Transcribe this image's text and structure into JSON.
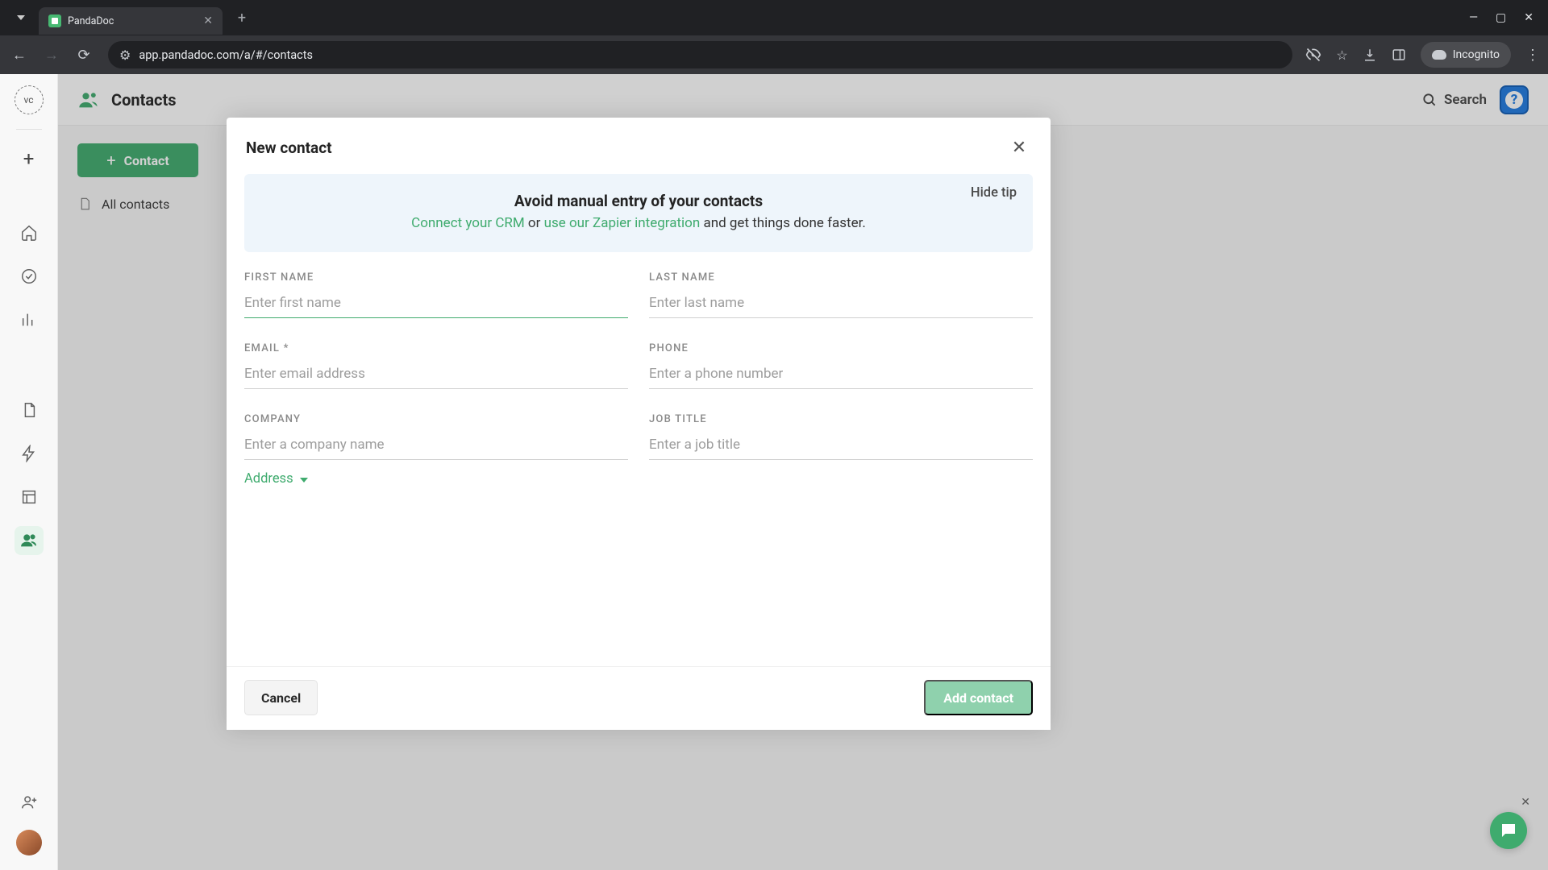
{
  "browser": {
    "tab_title": "PandaDoc",
    "url": "app.pandadoc.com/a/#/contacts",
    "incognito_label": "Incognito"
  },
  "header": {
    "title": "Contacts",
    "search_label": "Search"
  },
  "left_panel": {
    "new_contact_button": "+ Contact",
    "all_contacts_label": "All contacts"
  },
  "modal": {
    "title": "New contact",
    "tip": {
      "hide_label": "Hide tip",
      "headline": "Avoid manual entry of your contacts",
      "link_crm": "Connect your CRM",
      "mid_text": " or ",
      "link_zapier": "use our Zapier integration",
      "tail": " and get things done faster."
    },
    "fields": {
      "first_name": {
        "label": "FIRST NAME",
        "placeholder": "Enter first name",
        "value": ""
      },
      "last_name": {
        "label": "LAST NAME",
        "placeholder": "Enter last name",
        "value": ""
      },
      "email": {
        "label": "EMAIL *",
        "placeholder": "Enter email address",
        "value": ""
      },
      "phone": {
        "label": "PHONE",
        "placeholder": "Enter a phone number",
        "value": ""
      },
      "company": {
        "label": "COMPANY",
        "placeholder": "Enter a company name",
        "value": ""
      },
      "job_title": {
        "label": "JOB TITLE",
        "placeholder": "Enter a job title",
        "value": ""
      }
    },
    "address_toggle": "Address",
    "cancel": "Cancel",
    "submit": "Add contact"
  }
}
